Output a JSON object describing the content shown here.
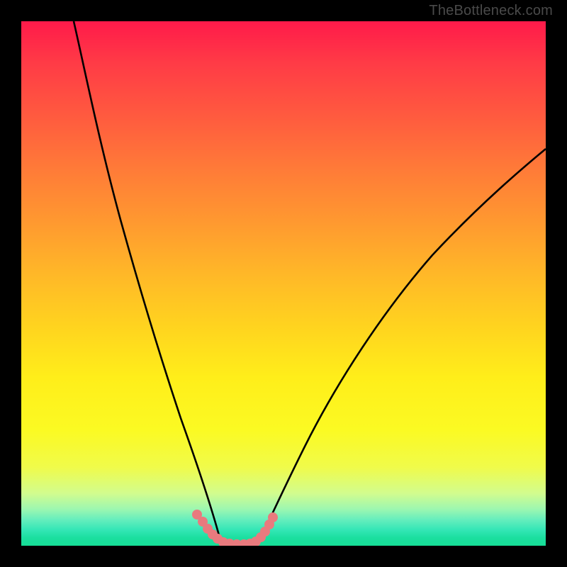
{
  "watermark": "TheBottleneck.com",
  "chart_data": {
    "type": "line",
    "title": "",
    "xlabel": "",
    "ylabel": "",
    "xlim": [
      0,
      100
    ],
    "ylim": [
      0,
      100
    ],
    "series": [
      {
        "name": "black-curve-left",
        "color": "#000000",
        "x": [
          10,
          12,
          15,
          18,
          22,
          26,
          30,
          33,
          36,
          38
        ],
        "y": [
          100,
          88,
          72,
          57,
          42,
          28,
          15,
          7,
          2,
          0
        ]
      },
      {
        "name": "black-curve-right",
        "color": "#000000",
        "x": [
          45,
          48,
          52,
          58,
          65,
          75,
          85,
          95,
          100
        ],
        "y": [
          0,
          3,
          8,
          17,
          28,
          42,
          55,
          65,
          70
        ]
      },
      {
        "name": "pink-marker-valley",
        "color": "#e97a7e",
        "x": [
          33.5,
          34.5,
          35.5,
          36.5,
          37.5,
          38.5,
          40,
          41.5,
          43,
          44,
          45,
          46,
          47
        ],
        "y": [
          6,
          4.5,
          3,
          1.8,
          1,
          0.5,
          0.3,
          0.3,
          0.5,
          1,
          1.8,
          3,
          5
        ]
      }
    ],
    "background_gradient": {
      "top": "#ff1a4a",
      "mid": "#ffee1a",
      "bottom": "#16dd96"
    }
  }
}
